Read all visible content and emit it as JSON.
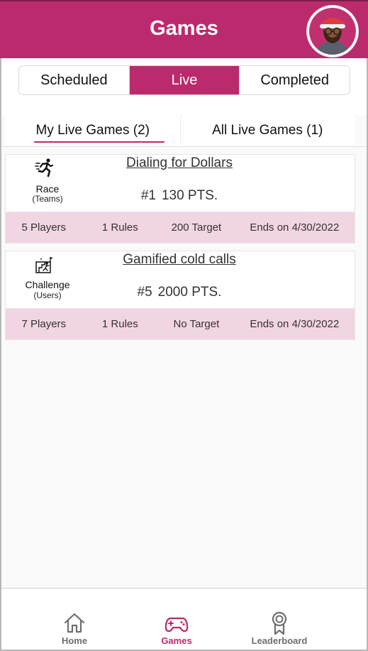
{
  "header": {
    "title": "Games"
  },
  "segments": [
    {
      "label": "Scheduled",
      "active": false
    },
    {
      "label": "Live",
      "active": true
    },
    {
      "label": "Completed",
      "active": false
    }
  ],
  "subtabs": [
    {
      "label": "My Live Games (2)",
      "active": true
    },
    {
      "label": "All Live Games (1)",
      "active": false
    }
  ],
  "games": [
    {
      "title": "Dialing for Dollars",
      "type": "Race",
      "type_sub": "(Teams)",
      "icon": "running-person-icon",
      "rank": "#1",
      "points": "130 PTS.",
      "players": "5 Players",
      "rules": "1 Rules",
      "target": "200 Target",
      "ends": "Ends on 4/30/2022"
    },
    {
      "title": "Gamified cold calls",
      "type": "Challenge",
      "type_sub": "(Users)",
      "icon": "challenge-climb-icon",
      "rank": "#5",
      "points": "2000 PTS.",
      "players": "7 Players",
      "rules": "1 Rules",
      "target": "No Target",
      "ends": "Ends on 4/30/2022"
    }
  ],
  "nav": [
    {
      "label": "Home",
      "icon": "home-icon",
      "active": false
    },
    {
      "label": "Games",
      "icon": "gamepad-icon",
      "active": true
    },
    {
      "label": "Leaderboard",
      "icon": "award-ribbon-icon",
      "active": false
    }
  ],
  "colors": {
    "accent": "#bb2a6c",
    "row_bg": "#f2d5e3"
  }
}
